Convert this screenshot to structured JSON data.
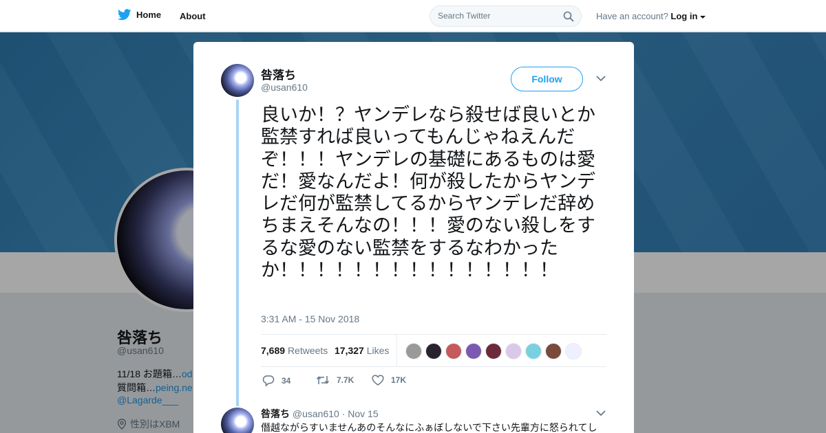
{
  "topbar": {
    "home_label": "Home",
    "about_label": "About",
    "search_placeholder": "Search Twitter",
    "account_prompt": "Have an account?",
    "login_label": "Log in"
  },
  "profile": {
    "name": "咎落ち",
    "handle": "@usan610",
    "bio_line1_prefix": "11/18 お題箱…",
    "bio_line1_link": "od",
    "bio_line2_prefix": "質問箱…",
    "bio_line2_link": "peing.ne",
    "bio_line3": "@Lagarde___",
    "location": "性別はXBM"
  },
  "tweet": {
    "author_name": "咎落ち",
    "author_handle": "@usan610",
    "follow_label": "Follow",
    "text": "良いか！？ヤンデレなら殺せば良いとか監禁すれば良いってもんじゃねえんだぞ！！！ヤンデレの基礎にあるものは愛だ！愛なんだよ！何が殺したからヤンデレだ何が監禁してるからヤンデレだ辞めちまえそんなの！！！愛のない殺しをするな愛のない監禁をするなわかった\nか！！！！！！！！！！！！！！！",
    "timestamp": "3:31 AM - 15 Nov 2018",
    "retweets_count": "7,689",
    "retweets_label": "Retweets",
    "likes_count": "17,327",
    "likes_label": "Likes",
    "reply_count": "34",
    "retweet_action_count": "7.7K",
    "like_action_count": "17K",
    "liker_colors": [
      "#9a9a9a",
      "#2b2230",
      "#c65a5a",
      "#7a5ab0",
      "#6b2a3a",
      "#d9c8e8",
      "#7ad0e0",
      "#7a4a3a",
      "#eef0ff"
    ]
  },
  "reply": {
    "author_name": "咎落ち",
    "author_handle": "@usan610",
    "date": "· Nov 15",
    "text": "僭越ながらすいませんあのそんなにふぁぼしないで下さい先輩方に怒られてし"
  }
}
